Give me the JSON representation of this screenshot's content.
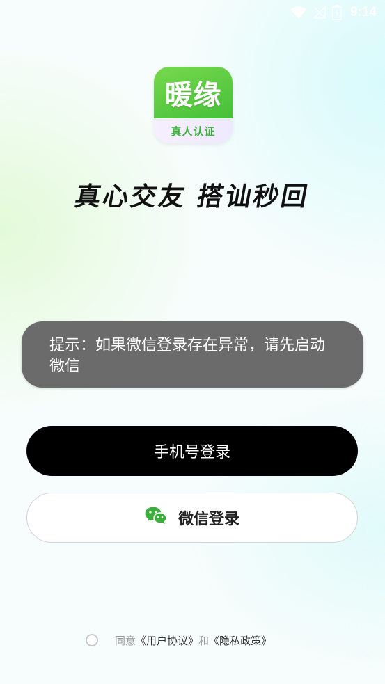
{
  "status_bar": {
    "time": "9:14",
    "icons": [
      "wifi-icon",
      "signal-off-icon",
      "battery-icon"
    ]
  },
  "logo": {
    "title": "暖缘",
    "badge": "真人认证"
  },
  "slogan": "真心交友 搭讪秒回",
  "toast": {
    "text": "提示：如果微信登录存在异常，请先启动微信"
  },
  "buttons": {
    "phone_login": "手机号登录",
    "wechat_login": "微信登录"
  },
  "agreement": {
    "prefix": "同意",
    "user_agreement": "《用户协议》",
    "conjunction": "和",
    "privacy_policy": "《隐私政策》"
  },
  "colors": {
    "brand_green": "#45c03a",
    "wechat_green": "#3cae3a",
    "primary_button": "#000000",
    "toast_bg": "#6b6b6b"
  }
}
